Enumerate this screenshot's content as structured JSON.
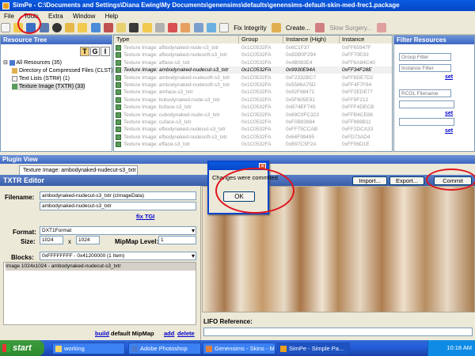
{
  "window": {
    "title": "SimPe - C:\\Documents and Settings\\Diana Ewing\\My Documents\\genensims\\defaults\\genensims-default-skin-med-frec1.package"
  },
  "menu": [
    "File",
    "Tools",
    "Extra",
    "Window",
    "Help"
  ],
  "toolbar": {
    "fix_integrity": "Fix Integrity",
    "create": "Create...",
    "slow_surgery": "Slow Surgery..."
  },
  "resource_tree": {
    "title": "Resource Tree",
    "mode_buttons": [
      "T",
      "G",
      "I"
    ],
    "items": [
      "All Resources (35)",
      "Directory of Compressed Files (CLST)",
      "Text Lists (STR#) (1)",
      "Texture Image (TXTR) (33)"
    ]
  },
  "resource_list": {
    "columns": [
      "Type",
      "Group",
      "Instance (High)",
      "Instance"
    ],
    "rows": [
      {
        "type": "Texture Image: afbodynaked-nude-s3_txtr",
        "group": "0x1C0532FA",
        "high": "0x6C1F37",
        "inst": "0xFF65947F",
        "sel": false
      },
      {
        "type": "Texture Image: afbodynaked-nudesoft-s3_txtr",
        "group": "0x1C0532FA",
        "high": "0x8DB0F294",
        "inst": "0xFF70E93",
        "sel": false
      },
      {
        "type": "Texture Image: afface-s3_txtr",
        "group": "0x1C0532FA",
        "high": "0x4B083E4",
        "inst": "0xFF6A84C40",
        "sel": false
      },
      {
        "type": "Texture Image: ambodynaked-nudecut-s3_txtr",
        "group": "0x1C0532FA",
        "high": "0x9930E94A",
        "inst": "0xFF34F28E",
        "sel": true
      },
      {
        "type": "Texture Image: ambodynaked-nudesoft-s3_txtr",
        "group": "0x1C0532FA",
        "high": "0xF2332BC7",
        "inst": "0xFF8DE7D2",
        "sel": false
      },
      {
        "type": "Texture Image: ambodynaked-nudesoft-s3_txtr",
        "group": "0x1C0532FA",
        "high": "0x5586A75D",
        "inst": "0xFF4F7F84",
        "sel": false
      },
      {
        "type": "Texture Image: amface-s3_txtr",
        "group": "0x1C0532FA",
        "high": "0x92F88471",
        "inst": "0xFF2EDE77",
        "sel": false
      },
      {
        "type": "Texture Image: bubodynaked-nude-s3_txtr",
        "group": "0x1C0532FA",
        "high": "0x5F605E91",
        "inst": "0xFF9F212",
        "sel": false
      },
      {
        "type": "Texture Image: buface-s3_txtr",
        "group": "0x1C0532FA",
        "high": "0xB74EF745",
        "inst": "0xFFF4DECB",
        "sel": false
      },
      {
        "type": "Texture Image: cubodynaked-nude-s3_txtr",
        "group": "0x1C0532FA",
        "high": "0x89C0FC323",
        "inst": "0xFFB4CE86",
        "sel": false
      },
      {
        "type": "Texture Image: cuface-s3_txtr",
        "group": "0x1C0532FA",
        "high": "0xF0B93884",
        "inst": "0xFF969B11",
        "sel": false
      },
      {
        "type": "Texture Image: efbodynaked-nudecut-s3_txtr",
        "group": "0x1C0532FA",
        "high": "0xFF75CCAB",
        "inst": "0xFF2DCA33",
        "sel": false
      },
      {
        "type": "Texture Image: efbodynaked-nudesoft-s3_txtr",
        "group": "0x1C0532FA",
        "high": "0x64F99495",
        "inst": "0xFD73AD4",
        "sel": false
      },
      {
        "type": "Texture Image: efface-s3_txtr",
        "group": "0x1C0532FA",
        "high": "0xB97C5F2A",
        "inst": "0xFF06D1E",
        "sel": false
      }
    ]
  },
  "filter": {
    "title": "Filter Resources",
    "group_filter": "Group Filter",
    "instance_filter": "Instance Filter",
    "rcol_filename": "RCOL Filename",
    "set_label": "set"
  },
  "plugin": {
    "bar_title": "Plugin View",
    "tab_label": "Texture Image: ambodynaked-nudecut-s3_txtr",
    "editor_title": "TXTR Editor",
    "import_label": "Import...",
    "export_label": "Export...",
    "commit_label": "Commit",
    "filename_label": "Filename:",
    "filename_value": "ambodynaked-nudecut-s3_txtr (cImageData)",
    "filename_value2": "ambodynaked-nudecut-s3_txtr",
    "fix_tgi": "fix TGI",
    "format_label": "Format:",
    "format_value": "DXT1Format",
    "size_label": "Size:",
    "size_w": "1024",
    "size_x": "x",
    "size_h": "1024",
    "mipmap_label": "MipMap Level:",
    "mipmap_value": "1",
    "blocks_label": "Blocks:",
    "blocks_value": "0xFFFFFFFF - 0x41200000 (1 Item)",
    "image_item": "Image 1024x1024 - ambodynaked-nudecut-s3_txtr",
    "build": "build",
    "default_mipmap": "default MipMap",
    "add": "add",
    "delete": "delete",
    "lifo_label": "LIFO Reference:"
  },
  "dialog": {
    "message": "Changes were commited",
    "ok_label": "OK"
  },
  "taskbar": {
    "start": "start",
    "tasks": [
      "working",
      "Adobe Photoshop",
      "Genensims - Skins - M...",
      "SimPe - Simple Pa..."
    ],
    "clock": "10:18 AM"
  },
  "colors": {
    "annotation": "#e0141e",
    "titlebar": "#0a5be0"
  }
}
